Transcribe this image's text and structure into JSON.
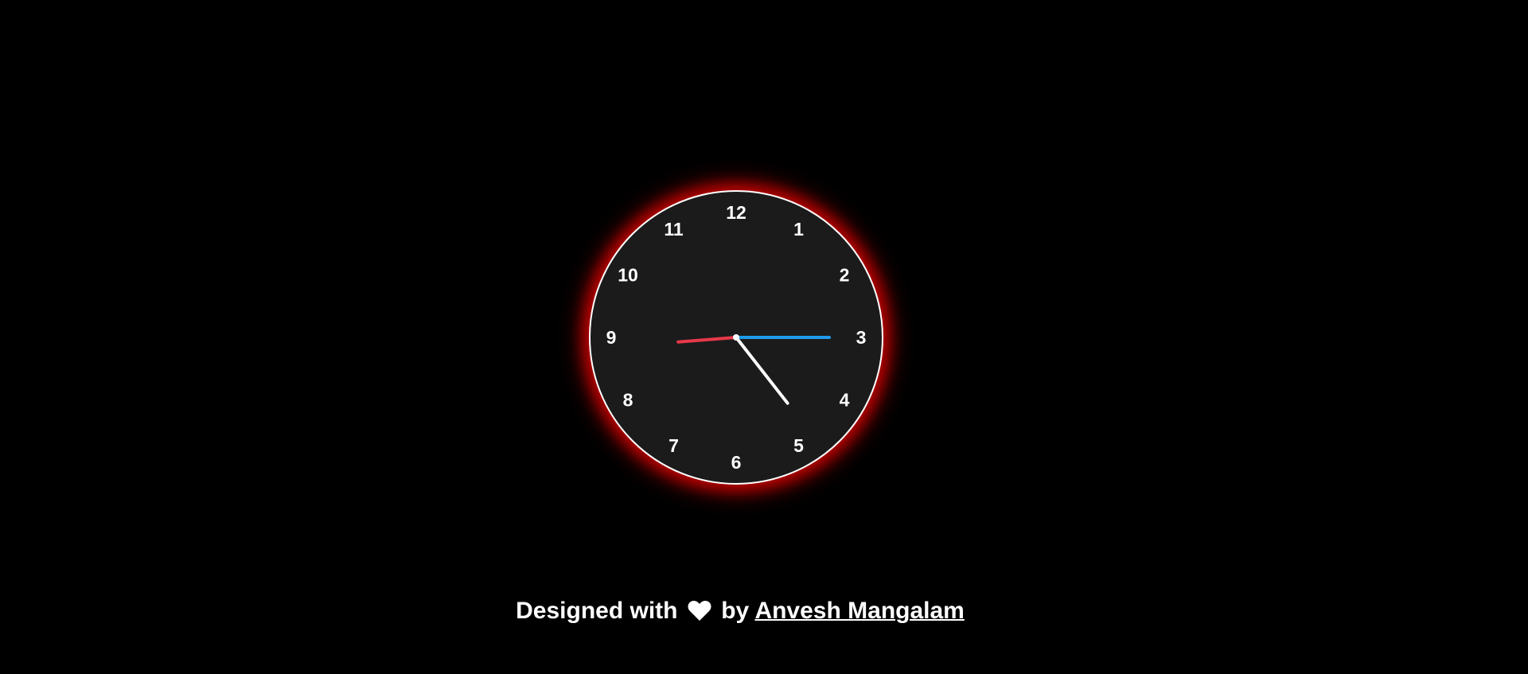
{
  "clock": {
    "numerals": [
      "12",
      "1",
      "2",
      "3",
      "4",
      "5",
      "6",
      "7",
      "8",
      "9",
      "10",
      "11"
    ],
    "time": {
      "hour": 4,
      "minute": 44,
      "second": 15
    },
    "colors": {
      "face": "#1b1b1b",
      "border": "#ffffff",
      "glow": "#c00000",
      "hour_hand": "#ffffff",
      "minute_hand": "#e8394a",
      "second_hand": "#1e9be8",
      "center": "#ffffff"
    }
  },
  "footer": {
    "prefix": "Designed with",
    "icon": "heart-icon",
    "by": "by",
    "author": "Anvesh Mangalam"
  }
}
